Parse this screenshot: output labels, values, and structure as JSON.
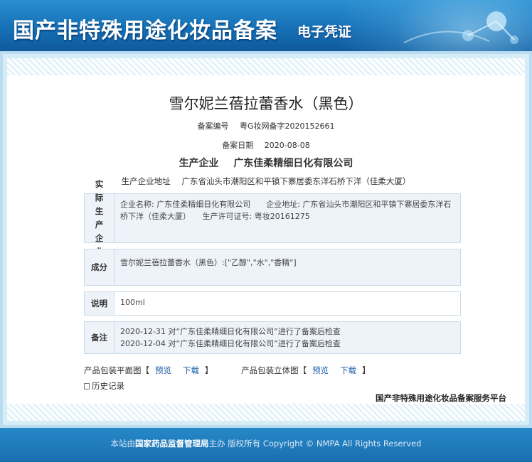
{
  "banner": {
    "title": "国产非特殊用途化妆品备案",
    "subtitle": "电子凭证"
  },
  "product": {
    "name": "雪尔妮兰蓓拉蕾香水（黑色）",
    "reg_label": "备案编号",
    "reg_value": "粤G妆网备字2020152661",
    "date_label": "备案日期",
    "date_value": "2020-08-08",
    "company_label": "生产企业",
    "company_value": "广东佳柔精细日化有限公司",
    "address_label": "生产企业地址",
    "address_value": "广东省汕头市潮阳区和平镇下寨居委东洋石桥下洋（佳柔大厦）"
  },
  "panels": {
    "actual": {
      "label": "实际生产企业",
      "text": "企业名称: 广东佳柔精细日化有限公司　　企业地址: 广东省汕头市潮阳区和平镇下寨居委东洋石桥下洋（佳柔大厦）　　生产许可证号: 粤妆20161275"
    },
    "ingredients": {
      "label": "成分",
      "text": "雪尔妮兰蓓拉蕾香水（黑色）:[\"乙醇\",\"水\",\"香精\"]"
    },
    "spec": {
      "label": "说明",
      "text": "100ml"
    },
    "remarks": {
      "label": "备注",
      "lines": [
        "2020-12-31 对“广东佳柔精细日化有限公司”进行了备案后检查",
        "2020-12-04 对“广东佳柔精细日化有限公司”进行了备案后检查"
      ]
    }
  },
  "packaging": {
    "flat_label": "产品包装平面图【",
    "flat_preview": "预览",
    "flat_download": "下载",
    "flat_close": "】",
    "solid_label": "产品包装立体图【",
    "solid_preview": "预览",
    "solid_download": "下载",
    "solid_close": "】"
  },
  "history_label": "历史记录",
  "platform_name": "国产非特殊用途化妆品备案服务平台",
  "footer": {
    "prefix": "本站由",
    "org": "国家药品监督管理局",
    "suffix": "主办 版权所有 Copyright © NMPA All Rights Reserved"
  },
  "colors": {
    "banner_blue": "#1670b6",
    "link_blue": "#1c5fa8",
    "panel_bg": "#eef3f9"
  }
}
